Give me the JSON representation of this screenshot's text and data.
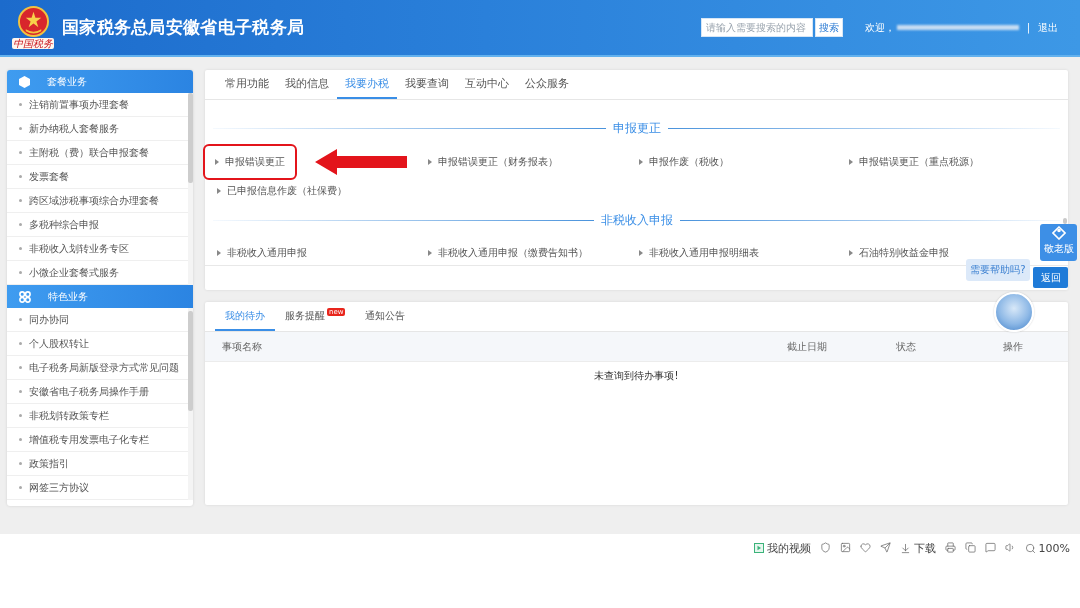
{
  "header": {
    "title": "国家税务总局安徽省电子税务局",
    "logo_caption": "中国税务",
    "search": {
      "placeholder": "请输入需要搜索的内容",
      "button": "搜索"
    },
    "welcome": "欢迎，",
    "separator": "|",
    "logout": "退出"
  },
  "sidebar": {
    "groups": [
      {
        "title": "套餐业务",
        "items": [
          "注销前置事项办理套餐",
          "新办纳税人套餐服务",
          "主附税（费）联合申报套餐",
          "发票套餐",
          "跨区域涉税事项综合办理套餐",
          "多税种综合申报",
          "非税收入划转业务专区",
          "小微企业套餐式服务"
        ]
      },
      {
        "title": "特色业务",
        "items": [
          "同办协同",
          "个人股权转让",
          "电子税务局新版登录方式常见问题",
          "安徽省电子税务局操作手册",
          "非税划转政策专栏",
          "增值税专用发票电子化专栏",
          "政策指引",
          "网签三方协议"
        ]
      }
    ]
  },
  "main_panel": {
    "tabs": [
      {
        "label": "常用功能",
        "selected": false
      },
      {
        "label": "我的信息",
        "selected": false
      },
      {
        "label": "我要办税",
        "selected": true
      },
      {
        "label": "我要查询",
        "selected": false
      },
      {
        "label": "互动中心",
        "selected": false
      },
      {
        "label": "公众服务",
        "selected": false
      }
    ],
    "sections": [
      {
        "title": "申报更正",
        "items": [
          {
            "label": "申报错误更正",
            "highlighted": true
          },
          {
            "label": "申报错误更正（财务报表）",
            "highlighted": false
          },
          {
            "label": "申报作废（税收）",
            "highlighted": false
          },
          {
            "label": "申报错误更正（重点税源）",
            "highlighted": false
          },
          {
            "label": "已申报信息作废（社保费）",
            "highlighted": false
          }
        ]
      },
      {
        "title": "非税收入申报",
        "items": [
          {
            "label": "非税收入通用申报",
            "highlighted": false
          },
          {
            "label": "非税收入通用申报（缴费告知书）",
            "highlighted": false
          },
          {
            "label": "非税收入通用申报明细表",
            "highlighted": false
          },
          {
            "label": "石油特别收益金申报",
            "highlighted": false
          }
        ]
      }
    ]
  },
  "floating": {
    "elder_mode": "敬老版",
    "help_bubble": "需要帮助吗?",
    "back": "返回"
  },
  "todo_panel": {
    "tabs": [
      {
        "label": "我的待办",
        "selected": true
      },
      {
        "label": "服务提醒",
        "selected": false,
        "badge": "new"
      },
      {
        "label": "通知公告",
        "selected": false
      }
    ],
    "columns": [
      "事项名称",
      "截止日期",
      "状态",
      "操作"
    ],
    "empty_message": "未查询到待办事项!"
  },
  "status_bar": {
    "video": "我的视频",
    "download": "下载",
    "zoom": "100%"
  }
}
